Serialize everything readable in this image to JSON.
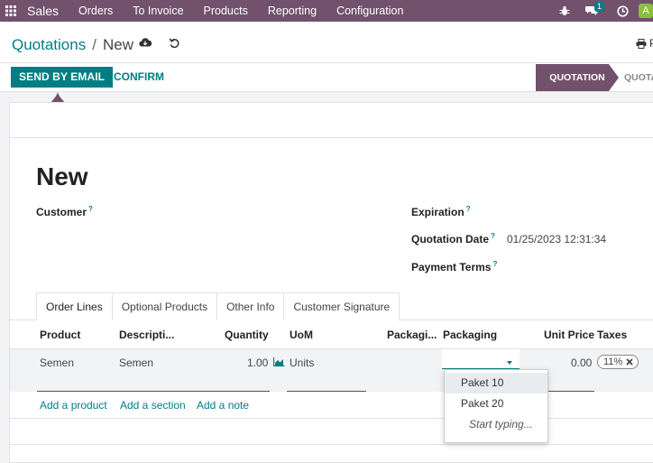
{
  "nav": {
    "app_name": "Sales",
    "menu": [
      "Orders",
      "To Invoice",
      "Products",
      "Reporting",
      "Configuration"
    ],
    "chat_badge": "1",
    "avatar_letter": "A"
  },
  "breadcrumb": {
    "parent": "Quotations",
    "separator": "/",
    "current": "New"
  },
  "toolbar": {
    "print_label": "P"
  },
  "actions": {
    "send_email": "SEND BY EMAIL",
    "confirm": "CONFIRM"
  },
  "status": {
    "current": "QUOTATION",
    "next": "QUOTA"
  },
  "form": {
    "title": "New",
    "customer_label": "Customer",
    "expiration_label": "Expiration",
    "quotation_date_label": "Quotation Date",
    "quotation_date_value": "01/25/2023 12:31:34",
    "payment_terms_label": "Payment Terms",
    "help_mark": "?"
  },
  "tabs": [
    "Order Lines",
    "Optional Products",
    "Other Info",
    "Customer Signature"
  ],
  "table": {
    "headers": [
      "Product",
      "Descripti...",
      "Quantity",
      "UoM",
      "Packagi...",
      "Packaging",
      "Unit Price",
      "Taxes"
    ],
    "row": {
      "product": "Semen",
      "description": "Semen",
      "quantity": "1.00",
      "uom": "Units",
      "unit_price": "0.00",
      "tax": "11%"
    },
    "add_links": [
      "Add a product",
      "Add a section",
      "Add a note"
    ]
  },
  "dropdown": {
    "options": [
      "Paket 10",
      "Paket 20"
    ],
    "hint": "Start typing..."
  },
  "colors": {
    "brand": "#71516c",
    "accent": "#017e84"
  }
}
